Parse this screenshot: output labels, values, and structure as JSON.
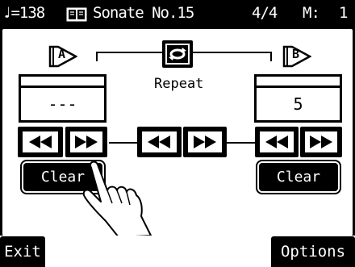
{
  "status": {
    "tempo": "♩=138",
    "song_title": "Sonate No.15",
    "time_signature": "4/4",
    "measure_label": "M:",
    "measure_value": "1"
  },
  "repeat": {
    "label": "Repeat",
    "a_marker": "A",
    "b_marker": "B",
    "a_value": "---",
    "b_value": "5"
  },
  "clear_a_label": "Clear",
  "clear_b_label": "Clear",
  "bottom": {
    "exit_label": "Exit",
    "options_label": "Options"
  }
}
